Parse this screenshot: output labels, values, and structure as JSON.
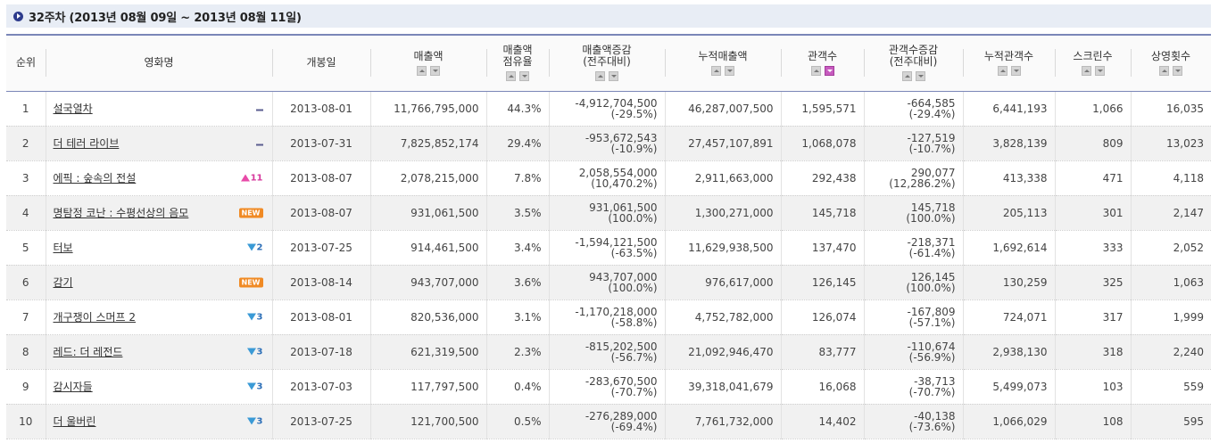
{
  "title": "32주차 (2013년 08월 09일 ~ 2013년 08월 11일)",
  "columns": {
    "rank": "순위",
    "movie": "영화명",
    "release": "개봉일",
    "sales": "매출액",
    "share_l1": "매출액",
    "share_l2": "점유율",
    "sales_change_l1": "매출액증감",
    "sales_change_l2": "(전주대비)",
    "cum_sales": "누적매출액",
    "audience": "관객수",
    "aud_change_l1": "관객수증감",
    "aud_change_l2": "(전주대비)",
    "cum_audience": "누적관객수",
    "screens": "스크린수",
    "shows": "상영횟수"
  },
  "rows": [
    {
      "rank": "1",
      "movie": "설국열차",
      "change_type": "same",
      "change_value": "",
      "release": "2013-08-01",
      "sales": "11,766,795,000",
      "share": "44.3%",
      "sales_change_amt": "-4,912,704,500",
      "sales_change_pct": "(-29.5%)",
      "cum_sales": "46,287,007,500",
      "audience": "1,595,571",
      "aud_change_amt": "-664,585",
      "aud_change_pct": "(-29.4%)",
      "cum_audience": "6,441,193",
      "screens": "1,066",
      "shows": "16,035"
    },
    {
      "rank": "2",
      "movie": "더 테러 라이브",
      "change_type": "same",
      "change_value": "",
      "release": "2013-07-31",
      "sales": "7,825,852,174",
      "share": "29.4%",
      "sales_change_amt": "-953,672,543",
      "sales_change_pct": "(-10.9%)",
      "cum_sales": "27,457,107,891",
      "audience": "1,068,078",
      "aud_change_amt": "-127,519",
      "aud_change_pct": "(-10.7%)",
      "cum_audience": "3,828,139",
      "screens": "809",
      "shows": "13,023"
    },
    {
      "rank": "3",
      "movie": "에픽 : 숲속의 전설",
      "change_type": "up",
      "change_value": "11",
      "release": "2013-08-07",
      "sales": "2,078,215,000",
      "share": "7.8%",
      "sales_change_amt": "2,058,554,000",
      "sales_change_pct": "(10,470.2%)",
      "cum_sales": "2,911,663,000",
      "audience": "292,438",
      "aud_change_amt": "290,077",
      "aud_change_pct": "(12,286.2%)",
      "cum_audience": "413,338",
      "screens": "471",
      "shows": "4,118"
    },
    {
      "rank": "4",
      "movie": "명탐정 코난 : 수평선상의 음모",
      "change_type": "new",
      "change_value": "NEW",
      "release": "2013-08-07",
      "sales": "931,061,500",
      "share": "3.5%",
      "sales_change_amt": "931,061,500",
      "sales_change_pct": "(100.0%)",
      "cum_sales": "1,300,271,000",
      "audience": "145,718",
      "aud_change_amt": "145,718",
      "aud_change_pct": "(100.0%)",
      "cum_audience": "205,113",
      "screens": "301",
      "shows": "2,147"
    },
    {
      "rank": "5",
      "movie": "터보",
      "change_type": "down",
      "change_value": "2",
      "release": "2013-07-25",
      "sales": "914,461,500",
      "share": "3.4%",
      "sales_change_amt": "-1,594,121,500",
      "sales_change_pct": "(-63.5%)",
      "cum_sales": "11,629,938,500",
      "audience": "137,470",
      "aud_change_amt": "-218,371",
      "aud_change_pct": "(-61.4%)",
      "cum_audience": "1,692,614",
      "screens": "333",
      "shows": "2,052"
    },
    {
      "rank": "6",
      "movie": "감기",
      "change_type": "new",
      "change_value": "NEW",
      "release": "2013-08-14",
      "sales": "943,707,000",
      "share": "3.6%",
      "sales_change_amt": "943,707,000",
      "sales_change_pct": "(100.0%)",
      "cum_sales": "976,617,000",
      "audience": "126,145",
      "aud_change_amt": "126,145",
      "aud_change_pct": "(100.0%)",
      "cum_audience": "130,259",
      "screens": "325",
      "shows": "1,063"
    },
    {
      "rank": "7",
      "movie": "개구쟁이 스머프 2",
      "change_type": "down",
      "change_value": "3",
      "release": "2013-08-01",
      "sales": "820,536,000",
      "share": "3.1%",
      "sales_change_amt": "-1,170,218,000",
      "sales_change_pct": "(-58.8%)",
      "cum_sales": "4,752,782,000",
      "audience": "126,074",
      "aud_change_amt": "-167,809",
      "aud_change_pct": "(-57.1%)",
      "cum_audience": "724,071",
      "screens": "317",
      "shows": "1,999"
    },
    {
      "rank": "8",
      "movie": "레드: 더 레전드",
      "change_type": "down",
      "change_value": "3",
      "release": "2013-07-18",
      "sales": "621,319,500",
      "share": "2.3%",
      "sales_change_amt": "-815,202,500",
      "sales_change_pct": "(-56.7%)",
      "cum_sales": "21,092,946,470",
      "audience": "83,777",
      "aud_change_amt": "-110,674",
      "aud_change_pct": "(-56.9%)",
      "cum_audience": "2,938,130",
      "screens": "318",
      "shows": "2,240"
    },
    {
      "rank": "9",
      "movie": "감시자들",
      "change_type": "down",
      "change_value": "3",
      "release": "2013-07-03",
      "sales": "117,797,500",
      "share": "0.4%",
      "sales_change_amt": "-283,670,500",
      "sales_change_pct": "(-70.7%)",
      "cum_sales": "39,318,041,679",
      "audience": "16,068",
      "aud_change_amt": "-38,713",
      "aud_change_pct": "(-70.7%)",
      "cum_audience": "5,499,073",
      "screens": "103",
      "shows": "559"
    },
    {
      "rank": "10",
      "movie": "더 울버린",
      "change_type": "down",
      "change_value": "3",
      "release": "2013-07-25",
      "sales": "121,700,500",
      "share": "0.5%",
      "sales_change_amt": "-276,289,000",
      "sales_change_pct": "(-69.4%)",
      "cum_sales": "7,761,732,000",
      "audience": "14,402",
      "aud_change_amt": "-40,138",
      "aud_change_pct": "(-73.6%)",
      "cum_audience": "1,066,029",
      "screens": "108",
      "shows": "595"
    }
  ],
  "colors": {
    "header_border": "#7a86b8",
    "title_bg": "#e8edf5",
    "up": "#e84aa8",
    "down": "#3a9ad6",
    "new_badge": "#f08a24"
  }
}
